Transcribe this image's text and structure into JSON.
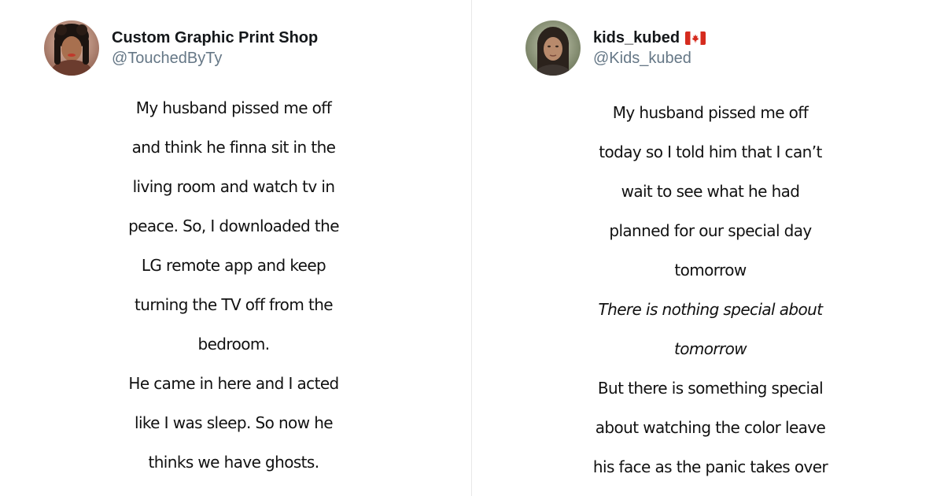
{
  "tweets": [
    {
      "display_name": "Custom Graphic Print Shop",
      "handle": "@TouchedByTy",
      "avatar_icon": "profile-photo-avatar",
      "lines": [
        {
          "text": "My husband pissed me off",
          "italic": false
        },
        {
          "text": "and think he finna sit in the",
          "italic": false
        },
        {
          "text": "living room and watch tv in",
          "italic": false
        },
        {
          "text": "peace. So, I downloaded the",
          "italic": false
        },
        {
          "text": "LG remote app and keep",
          "italic": false
        },
        {
          "text": "turning the TV off from the",
          "italic": false
        },
        {
          "text": "bedroom.",
          "italic": false
        },
        {
          "text": "He came in here and I acted",
          "italic": false
        },
        {
          "text": "like I was sleep. So now he",
          "italic": false
        },
        {
          "text": "thinks we have ghosts.",
          "italic": false
        }
      ]
    },
    {
      "display_name": "kids_kubed",
      "name_icon": "canada-flag-icon",
      "handle": "@Kids_kubed",
      "avatar_icon": "profile-photo-avatar",
      "lines": [
        {
          "text": "My husband pissed me off",
          "italic": false
        },
        {
          "text": "today so I told him that I can’t",
          "italic": false
        },
        {
          "text": "wait to see what he had",
          "italic": false
        },
        {
          "text": "planned for our special day",
          "italic": false
        },
        {
          "text": "tomorrow",
          "italic": false
        },
        {
          "text": "There is nothing special about",
          "italic": true
        },
        {
          "text": "tomorrow",
          "italic": true
        },
        {
          "text": "But there is something special",
          "italic": false
        },
        {
          "text": "about watching the color leave",
          "italic": false
        },
        {
          "text": "his face as the panic takes over",
          "italic": false
        }
      ]
    }
  ],
  "colors": {
    "name": "#14171a",
    "handle": "#657786",
    "body_text": "#111111",
    "flag_red": "#d52b1e"
  }
}
